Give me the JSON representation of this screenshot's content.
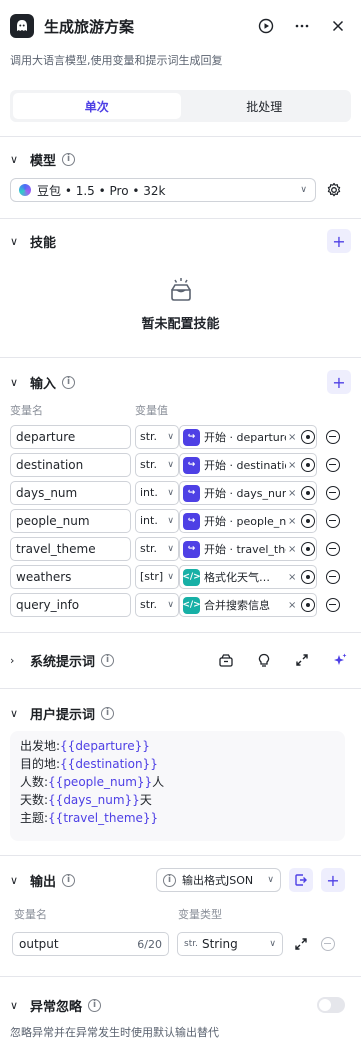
{
  "header": {
    "title": "生成旅游方案",
    "description": "调用大语言模型,使用变量和提示词生成回复"
  },
  "tabs": [
    {
      "label": "单次",
      "active": true
    },
    {
      "label": "批处理",
      "active": false
    }
  ],
  "model_section": {
    "title": "模型",
    "selected": "豆包 • 1.5 • Pro • 32k"
  },
  "skills_section": {
    "title": "技能",
    "empty_text": "暂未配置技能"
  },
  "input_section": {
    "title": "输入",
    "col_name": "变量名",
    "col_value": "变量值",
    "rows": [
      {
        "name": "departure",
        "type": "str.",
        "source_kind": "start",
        "value": "开始 · departure"
      },
      {
        "name": "destination",
        "type": "str.",
        "source_kind": "start",
        "value": "开始 · destination"
      },
      {
        "name": "days_num",
        "type": "int.",
        "source_kind": "start",
        "value": "开始 · days_num"
      },
      {
        "name": "people_num",
        "type": "int.",
        "source_kind": "start",
        "value": "开始 · people_num"
      },
      {
        "name": "travel_theme",
        "type": "str.",
        "source_kind": "start",
        "value": "开始 · travel_theme"
      },
      {
        "name": "weathers",
        "type": "[str]",
        "source_kind": "code",
        "value": "格式化天气…"
      },
      {
        "name": "query_info",
        "type": "str.",
        "source_kind": "code",
        "value": "合并搜索信息"
      }
    ]
  },
  "system_prompt_section": {
    "title": "系统提示词"
  },
  "user_prompt_section": {
    "title": "用户提示词",
    "lines": [
      {
        "label": "出发地:",
        "var": "{{departure}}",
        "suffix": ""
      },
      {
        "label": "目的地:",
        "var": "{{destination}}",
        "suffix": ""
      },
      {
        "label": "人数:",
        "var": "{{people_num}}",
        "suffix": "人"
      },
      {
        "label": "天数:",
        "var": "{{days_num}}",
        "suffix": "天"
      },
      {
        "label": "主题:",
        "var": "{{travel_theme}}",
        "suffix": ""
      }
    ]
  },
  "output_section": {
    "title": "输出",
    "format_label": "输出格式JSON",
    "col_name": "变量名",
    "col_type": "变量类型",
    "row": {
      "name": "output",
      "count": "6/20",
      "type_tag": "str.",
      "type": "String"
    }
  },
  "ignore_section": {
    "title": "异常忽略",
    "description": "忽略异常并在异常发生时使用默认输出替代",
    "enabled": false
  },
  "colors": {
    "accent": "#4e40e5",
    "code_node": "#17b0a6"
  }
}
